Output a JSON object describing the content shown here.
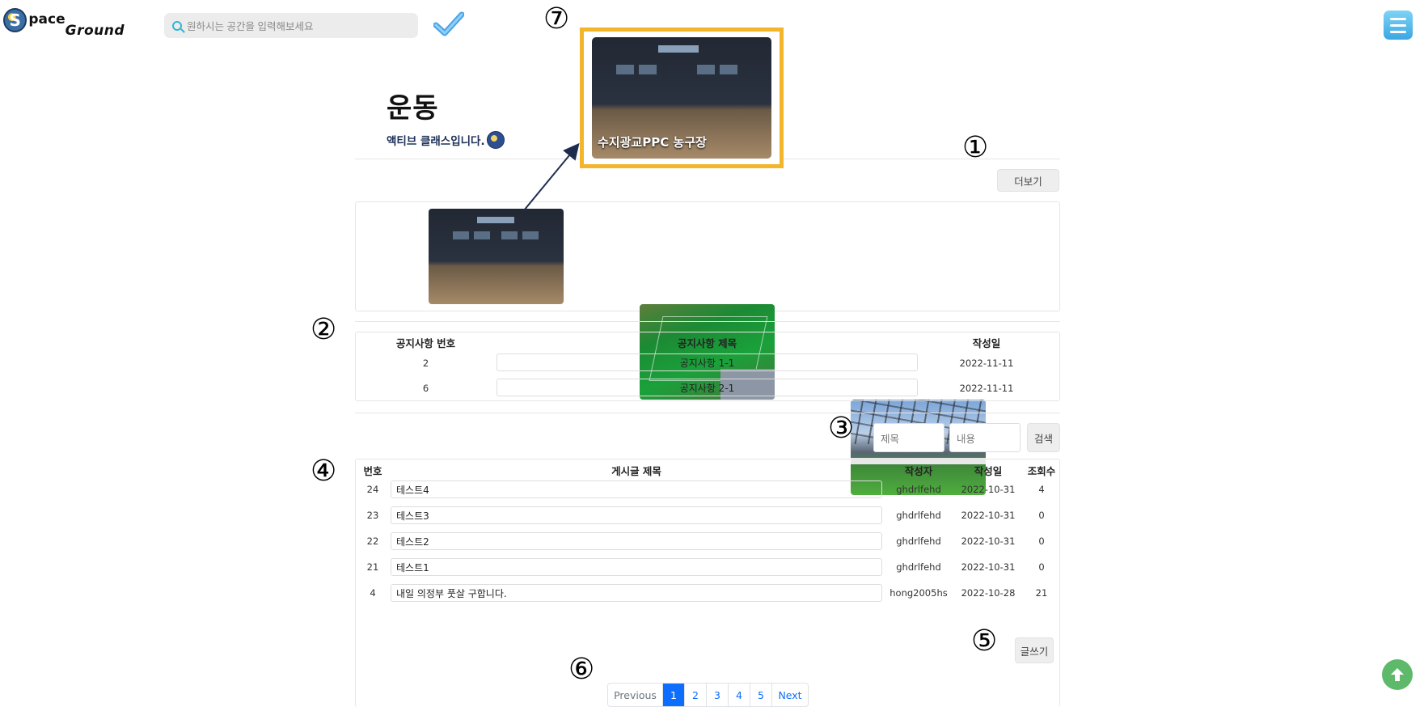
{
  "header": {
    "logo_s": "S",
    "logo_pace": "pace",
    "logo_ground": "Ground",
    "search_placeholder": "원하시는 공간을 입력해보세요"
  },
  "category": {
    "title": "운동",
    "subtitle": "액티브 클래스입니다."
  },
  "more_button": "더보기",
  "thumbnails": [
    "basketball-court",
    "soccer-field",
    "indoor-dome-field"
  ],
  "callout": {
    "label": "수지광교PPC 농구장"
  },
  "markers": [
    "①",
    "②",
    "③",
    "④",
    "⑤",
    "⑥",
    "⑦"
  ],
  "notice": {
    "headers": [
      "공지사항 번호",
      "공지사항 제목",
      "작성일"
    ],
    "rows": [
      {
        "no": "2",
        "title": "공지사항 1-1",
        "date": "2022-11-11"
      },
      {
        "no": "6",
        "title": "공지사항 2-1",
        "date": "2022-11-11"
      }
    ]
  },
  "search_form": {
    "title_placeholder": "제목",
    "content_placeholder": "내용",
    "search_button": "검색"
  },
  "board": {
    "headers": [
      "번호",
      "게시글 제목",
      "작성자",
      "작성일",
      "조회수"
    ],
    "rows": [
      {
        "no": "24",
        "title": "테스트4",
        "author": "ghdrlfehd",
        "date": "2022-10-31",
        "views": "4"
      },
      {
        "no": "23",
        "title": "테스트3",
        "author": "ghdrlfehd",
        "date": "2022-10-31",
        "views": "0"
      },
      {
        "no": "22",
        "title": "테스트2",
        "author": "ghdrlfehd",
        "date": "2022-10-31",
        "views": "0"
      },
      {
        "no": "21",
        "title": "테스트1",
        "author": "ghdrlfehd",
        "date": "2022-10-31",
        "views": "0"
      },
      {
        "no": "4",
        "title": "내일 의정부 풋살 구합니다.",
        "author": "hong2005hs",
        "date": "2022-10-28",
        "views": "21"
      }
    ]
  },
  "write_button": "글쓰기",
  "pagination": {
    "prev": "Previous",
    "pages": [
      "1",
      "2",
      "3",
      "4",
      "5"
    ],
    "active": "1",
    "next": "Next"
  },
  "colors": {
    "accent_blue": "#0d6efd",
    "callout_border": "#f3b62b",
    "scroll_top": "#5fb96a"
  }
}
